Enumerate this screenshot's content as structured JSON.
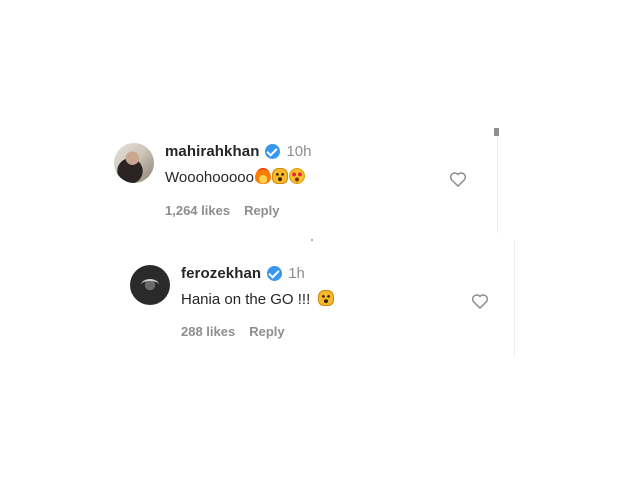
{
  "comments": [
    {
      "username": "mahirahkhan",
      "time": "10h",
      "text": "Wooohooooo",
      "emojis": [
        "fire-emoji",
        "screaming-face-emoji",
        "heart-eyes-emoji"
      ],
      "likes": "1,264 likes",
      "reply": "Reply"
    },
    {
      "username": "ferozekhan",
      "time": "1h",
      "text": "Hania on the GO !!!",
      "emojis": [
        "screaming-face-emoji"
      ],
      "likes": "288 likes",
      "reply": "Reply"
    }
  ],
  "icons": {
    "like": "heart-outline-icon",
    "verified": "verified-badge-icon"
  },
  "colors": {
    "username": "#262626",
    "muted": "#8e8e8e",
    "verified": "#3797f0",
    "background": "#ffffff"
  }
}
